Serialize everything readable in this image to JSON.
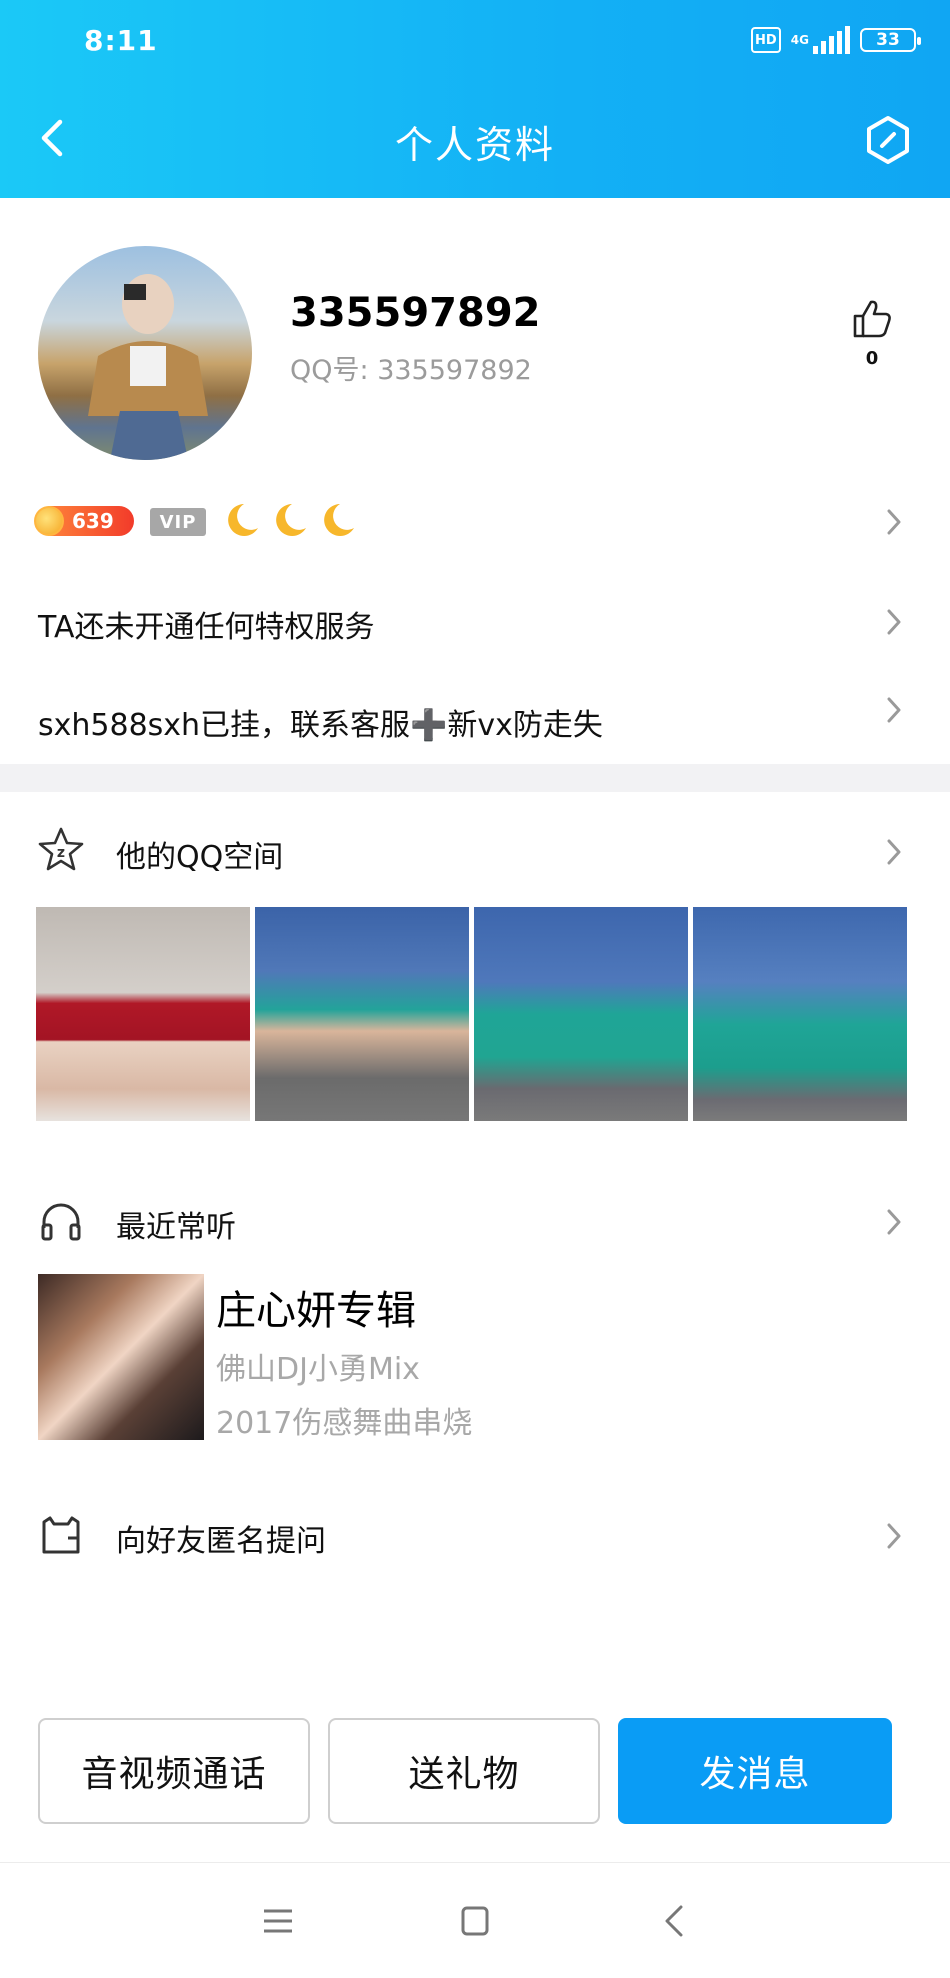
{
  "status_bar": {
    "time": "8:11",
    "hd": "HD",
    "network": "4G",
    "battery": "33"
  },
  "header": {
    "title": "个人资料"
  },
  "profile": {
    "nickname": "335597892",
    "qq_label": "QQ号:",
    "qq_number": "335597892",
    "like_count": "0",
    "level": "639",
    "vip_label": "VIP"
  },
  "rows": {
    "privilege": "TA还未开通任何特权服务",
    "signature": "sxh588sxh已挂，联系客服➕新vx防走失"
  },
  "qzone": {
    "title": "他的QQ空间"
  },
  "music": {
    "title": "最近常听",
    "album": "庄心妍专辑",
    "artist": "佛山DJ小勇Mix",
    "desc": "2017伤感舞曲串烧"
  },
  "ask": {
    "title": "向好友匿名提问"
  },
  "buttons": {
    "call": "音视频通话",
    "gift": "送礼物",
    "message": "发消息"
  },
  "colors": {
    "header_start": "#1bc9f7",
    "header_end": "#10a6f3",
    "primary": "#0a9cf5"
  }
}
